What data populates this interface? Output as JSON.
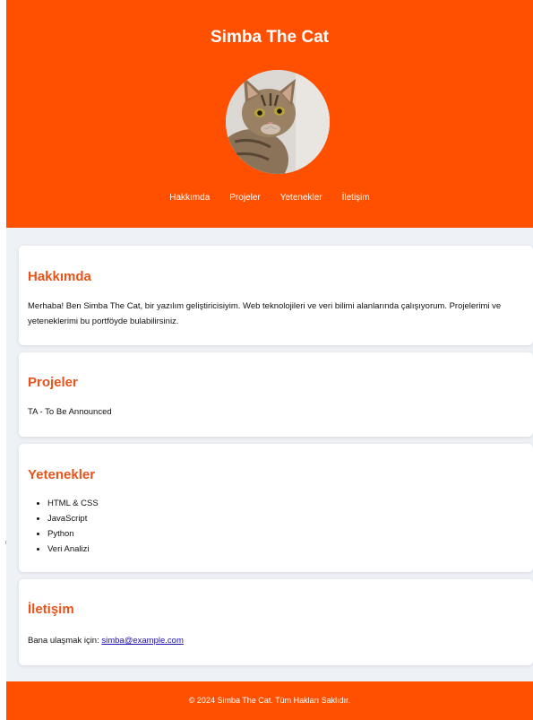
{
  "header": {
    "title": "Simba The Cat",
    "avatar_icon": "cat-photo",
    "nav": [
      "Hakkımda",
      "Projeler",
      "Yetenekler",
      "İletişim"
    ]
  },
  "about": {
    "heading": "Hakkımda",
    "text": "Merhaba! Ben Simba The Cat, bir yazılım geliştiricisiyim. Web teknolojileri ve veri bilimi alanlarında çalışıyorum. Projelerimi ve yeteneklerimi bu portföyde bulabilirsiniz."
  },
  "projects": {
    "heading": "Projeler",
    "text": "TA - To Be Announced"
  },
  "skills": {
    "heading": "Yetenekler",
    "items": [
      "HTML & CSS",
      "JavaScript",
      "Python",
      "Veri Analizi"
    ]
  },
  "contact": {
    "heading": "İletişim",
    "prefix": "Bana ulaşmak için:",
    "email": "simba@example.com"
  },
  "footer": {
    "text": "© 2024 Simba The Cat. Tüm Hakları Saklıdır."
  },
  "colors": {
    "brand": "#fe5000",
    "heading": "#e8531c",
    "background": "#eef1f6",
    "link": "#1a0dab"
  }
}
